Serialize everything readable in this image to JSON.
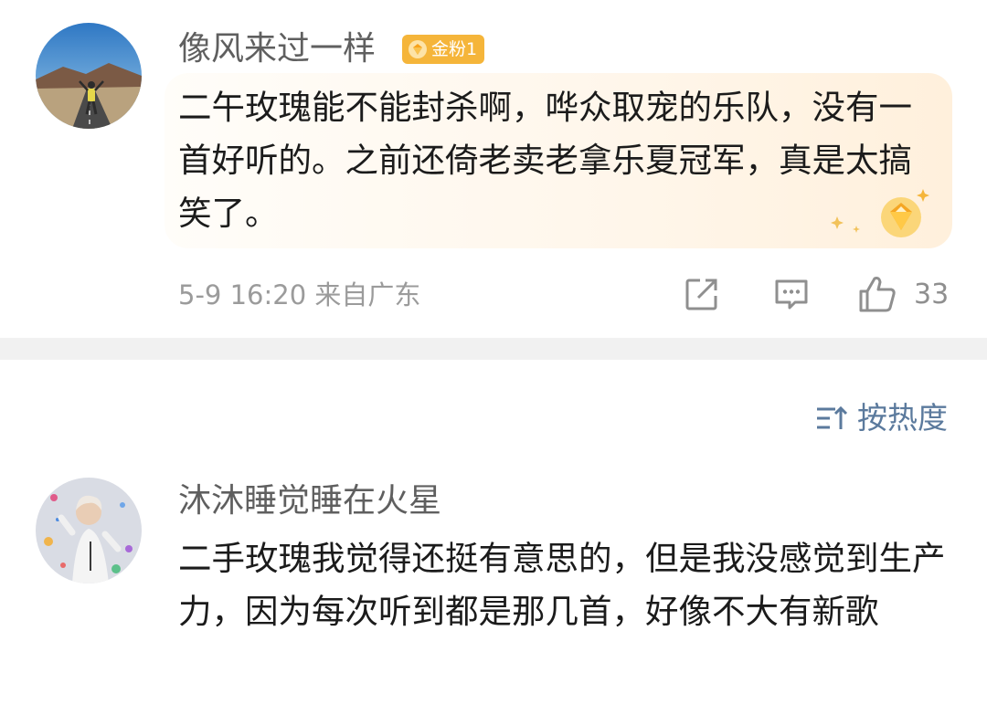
{
  "comments": [
    {
      "username": "像风来过一样",
      "badge": {
        "label": "金粉1",
        "icon": "gem-badge-icon",
        "color": "#f5b53a"
      },
      "text": "二午玫瑰能不能封杀啊，哗众取宠的乐队，没有一首好听的。之前还倚老卖老拿乐夏冠军，真是太搞笑了。",
      "meta": "5-9 16:20  来自广东",
      "like_count": "33"
    },
    {
      "username": "沐沐睡觉睡在火星",
      "text": "二手玫瑰我觉得还挺有意思的，但是我没感觉到生产力，因为每次听到都是那几首，好像不大有新歌"
    }
  ],
  "sort": {
    "label": "按热度",
    "icon": "sort-icon"
  },
  "icons": {
    "share": "share-icon",
    "comment": "comment-icon",
    "like": "thumbs-up-icon"
  },
  "colors": {
    "bubble": "#fff3e3",
    "link": "#5b7a9d",
    "badge": "#f5b53a",
    "divider": "#f1f1f1"
  }
}
